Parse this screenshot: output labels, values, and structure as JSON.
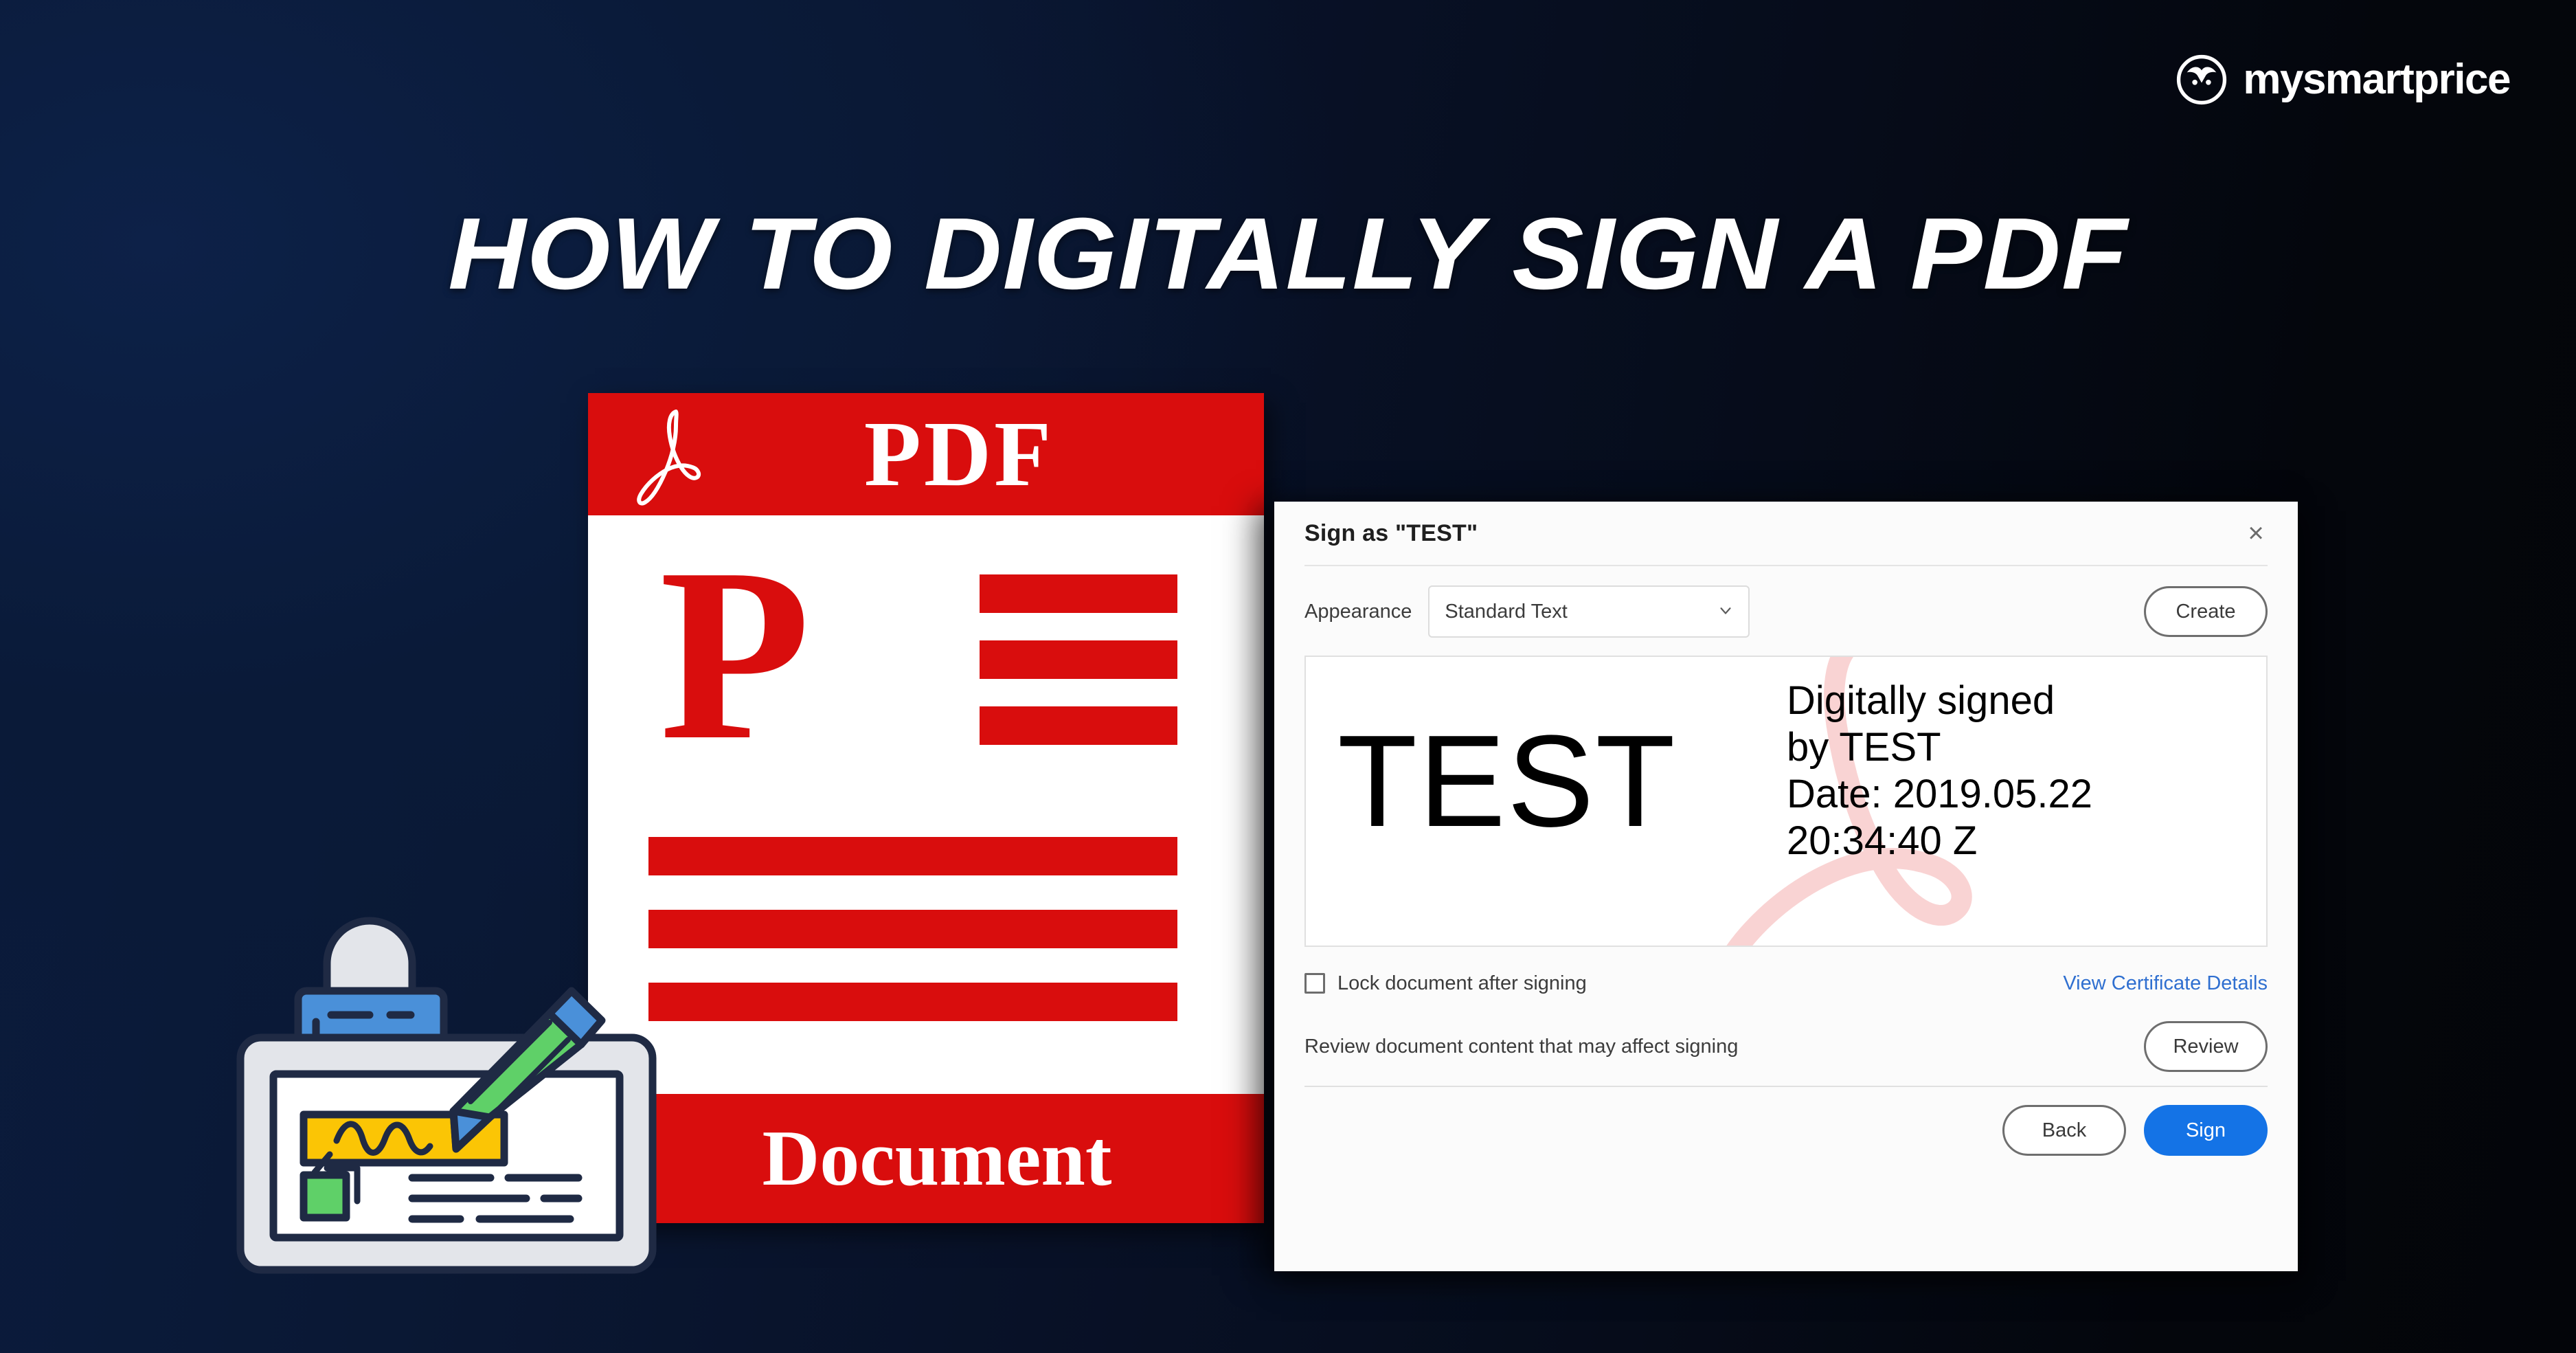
{
  "brand": {
    "name": "mysmartprice",
    "logo_icon": "owl-mark-icon"
  },
  "headline": {
    "text": "HOW TO DIGITALLY SIGN A PDF"
  },
  "pdf_card": {
    "header_label": "PDF",
    "header_icon": "adobe-acrobat-a-icon",
    "body_letter": "P",
    "footer_label": "Document",
    "accent_color": "#d90d0d"
  },
  "illustration": {
    "name": "document-signing-illustration",
    "icons": [
      "padlock-icon",
      "pen-icon",
      "signature-field-icon",
      "stamp-icon"
    ],
    "colors": {
      "outline": "#1f2a44",
      "lock_body": "#4a90d9",
      "lock_shackle": "#e3e5ea",
      "pen_body": "#5fd068",
      "pen_tip": "#4a90d9",
      "signature_field": "#fbc505",
      "stamp": "#5fd068",
      "card": "#e3e5ea"
    }
  },
  "dialog": {
    "title": "Sign as \"TEST\"",
    "close_label": "×",
    "appearance": {
      "label": "Appearance",
      "selected": "Standard Text",
      "options": [
        "Standard Text"
      ],
      "chevron_icon": "chevron-down-icon"
    },
    "create_button": "Create",
    "signature_preview": {
      "name": "TEST",
      "watermark_icon": "adobe-acrobat-a-watermark-icon",
      "details_line1": "Digitally signed",
      "details_line2": "by TEST",
      "details_line3": "Date: 2019.05.22",
      "details_line4": "20:34:40 Z"
    },
    "lock_checkbox": {
      "label": "Lock document after signing",
      "checked": false
    },
    "certificate_link": "View Certificate Details",
    "review_text": "Review document content that may affect signing",
    "review_button": "Review",
    "back_button": "Back",
    "sign_button": "Sign",
    "accent_color": "#1473e6",
    "link_color": "#2f6fd0"
  }
}
